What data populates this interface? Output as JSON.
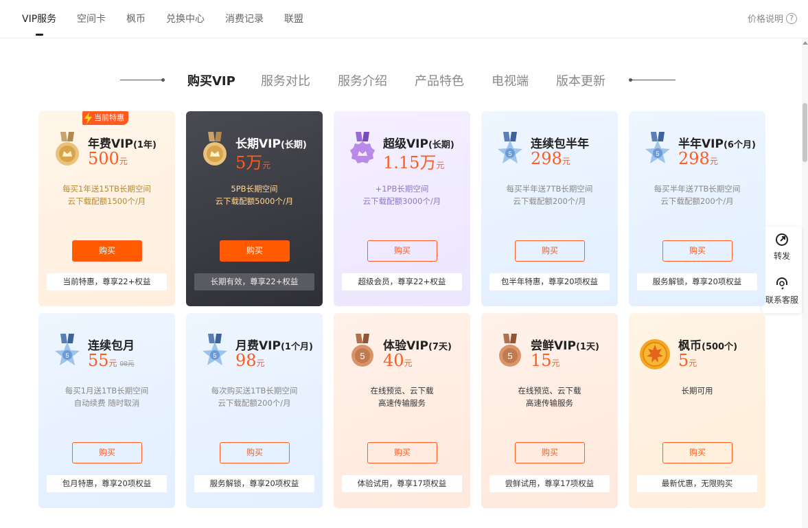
{
  "topnav": {
    "tabs": [
      "VIP服务",
      "空间卡",
      "枫币",
      "兑换中心",
      "消费记录",
      "联盟"
    ],
    "price_help": "价格说明",
    "help_glyph": "?"
  },
  "secnav": {
    "items": [
      "购买VIP",
      "服务对比",
      "服务介绍",
      "产品特色",
      "电视端",
      "版本更新"
    ]
  },
  "floattool": {
    "share": "转发",
    "service": "联系客服"
  },
  "colors": {
    "accent": "#ff5a1f",
    "dark_card": "#3a3a42"
  },
  "cards": [
    {
      "tag": "当前特惠",
      "name": "年费VIP",
      "sub": "(1年)",
      "price": "500",
      "unit": "元",
      "orig": "",
      "desc1": "每买1年送15TB长期空间",
      "desc2": "云下载配额1500个/月",
      "buy": "购买",
      "foot": "当前特惠，尊享22+权益",
      "badge": "gold-medal-icon"
    },
    {
      "name": "长期VIP",
      "sub": "(长期)",
      "price": "5万",
      "unit": "元",
      "orig": "",
      "desc1": "5PB长期空间",
      "desc2": "云下载配额5000个/月",
      "buy": "购买",
      "foot": "长期有效，尊享22+权益",
      "badge": "gold-crown-medal-icon"
    },
    {
      "name": "超级VIP",
      "sub": "(长期)",
      "price": "1.15万",
      "unit": "元",
      "orig": "",
      "desc1": "+1PB长期空间",
      "desc2": "云下载配额3000个/月",
      "buy": "购买",
      "foot": "超级会员，尊享22+权益",
      "badge": "purple-crown-medal-icon"
    },
    {
      "name": "连续包半年",
      "sub": "",
      "price": "298",
      "unit": "元",
      "orig": "",
      "desc1": "每买半年送7TB长期空间",
      "desc2": "云下载配额200个/月",
      "buy": "购买",
      "foot": "包半年特惠，尊享20项权益",
      "badge": "blue-star-medal-icon"
    },
    {
      "name": "半年VIP",
      "sub": "(6个月)",
      "price": "298",
      "unit": "元",
      "orig": "",
      "desc1": "每买半年送7TB长期空间",
      "desc2": "云下载配额200个/月",
      "buy": "购买",
      "foot": "服务解锁，尊享20项权益",
      "badge": "blue-star-medal-icon"
    },
    {
      "name": "连续包月",
      "sub": "",
      "price": "55",
      "unit": "元",
      "orig": "98元",
      "desc1": "每买1月送1TB长期空间",
      "desc2": "自动续费 随时取消",
      "buy": "购买",
      "foot": "包月特惠，尊享20项权益",
      "badge": "blue-star-medal-icon"
    },
    {
      "name": "月费VIP",
      "sub": "(1个月)",
      "price": "98",
      "unit": "元",
      "orig": "",
      "desc1": "每次购买送1TB长期空间",
      "desc2": "云下载配额200个/月",
      "buy": "购买",
      "foot": "服务解锁，尊享20项权益",
      "badge": "blue-star-medal-icon"
    },
    {
      "name": "体验VIP",
      "sub": "(7天)",
      "price": "40",
      "unit": "元",
      "orig": "",
      "desc1": "在线预览、云下载",
      "desc2": "高速传输服务",
      "buy": "购买",
      "foot": "体验试用，尊享17项权益",
      "badge": "bronze-medal-icon"
    },
    {
      "name": "尝鲜VIP",
      "sub": "(1天)",
      "price": "15",
      "unit": "元",
      "orig": "",
      "desc1": "在线预览、云下载",
      "desc2": "高速传输服务",
      "buy": "购买",
      "foot": "尝鲜试用，尊享17项权益",
      "badge": "bronze-medal-icon"
    },
    {
      "name": "枫币",
      "sub": "(500个)",
      "price": "5",
      "unit": "元",
      "orig": "",
      "desc1": "长期可用",
      "desc2": "",
      "buy": "购买",
      "foot": "最新优惠，无限购买",
      "badge": "maple-coin-icon"
    }
  ]
}
